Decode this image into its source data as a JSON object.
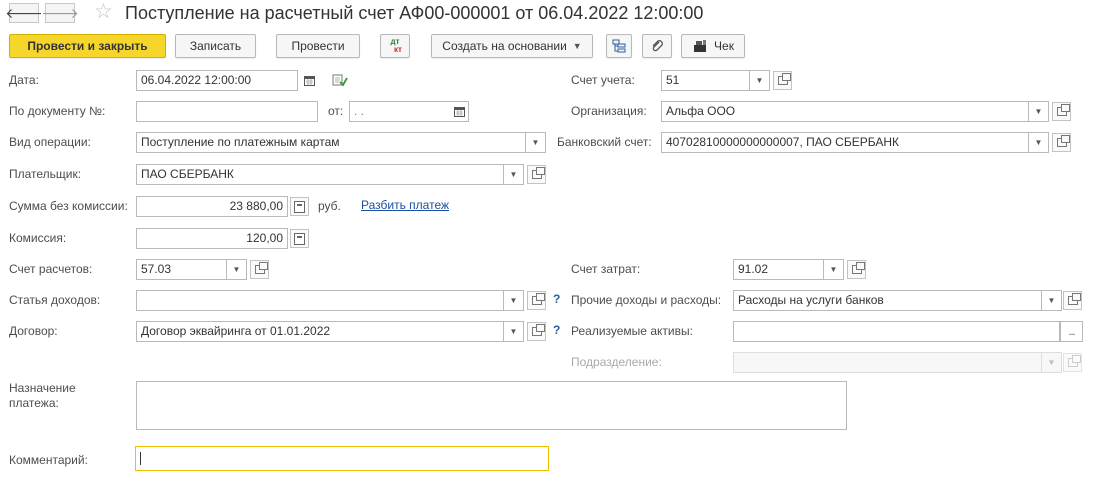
{
  "header": {
    "title": "Поступление на расчетный счет АФ00-000001 от 06.04.2022 12:00:00",
    "back": "🡐",
    "forward": "🡒",
    "star": "☆"
  },
  "toolbar": {
    "post_close": "Провести и закрыть",
    "save": "Записать",
    "post": "Провести",
    "dt_kt_top": "дт",
    "dt_kt_bottom": "кт",
    "create_based": "Создать на основании",
    "receipt": "Чек"
  },
  "form": {
    "date_label": "Дата:",
    "date_value": "06.04.2022 12:00:00",
    "account_label": "Счет учета:",
    "account_value": "51",
    "doc_no_label": "По документу №:",
    "doc_no_value": "",
    "from_label": "от:",
    "from_value": "  .  .",
    "org_label": "Организация:",
    "org_value": "Альфа ООО",
    "op_type_label": "Вид операции:",
    "op_type_value": "Поступление по платежным картам",
    "bank_acc_label": "Банковский счет:",
    "bank_acc_value": "40702810000000000007, ПАО СБЕРБАНК",
    "payer_label": "Плательщик:",
    "payer_value": "ПАО СБЕРБАНК",
    "sum_label": "Сумма без комиссии:",
    "sum_value": "23 880,00",
    "currency": "руб.",
    "split_link": "Разбить платеж",
    "fee_label": "Комиссия:",
    "fee_value": "120,00",
    "settle_acc_label": "Счет расчетов:",
    "settle_acc_value": "57.03",
    "expense_acc_label": "Счет затрат:",
    "expense_acc_value": "91.02",
    "income_item_label": "Статья доходов:",
    "income_item_value": "",
    "other_label": "Прочие доходы и расходы:",
    "other_value": "Расходы на услуги банков",
    "contract_label": "Договор:",
    "contract_value": "Договор эквайринга от 01.01.2022",
    "assets_label": "Реализуемые активы:",
    "assets_value": "",
    "assets_btn": "...",
    "division_label": "Подразделение:",
    "division_value": "",
    "purpose_label": "Назначение платежа:",
    "comment_label": "Комментарий:",
    "help": "?"
  },
  "colors": {
    "primary_button": "#f7d62c",
    "focus_border": "#f0c000",
    "link": "#1c4fa2"
  }
}
